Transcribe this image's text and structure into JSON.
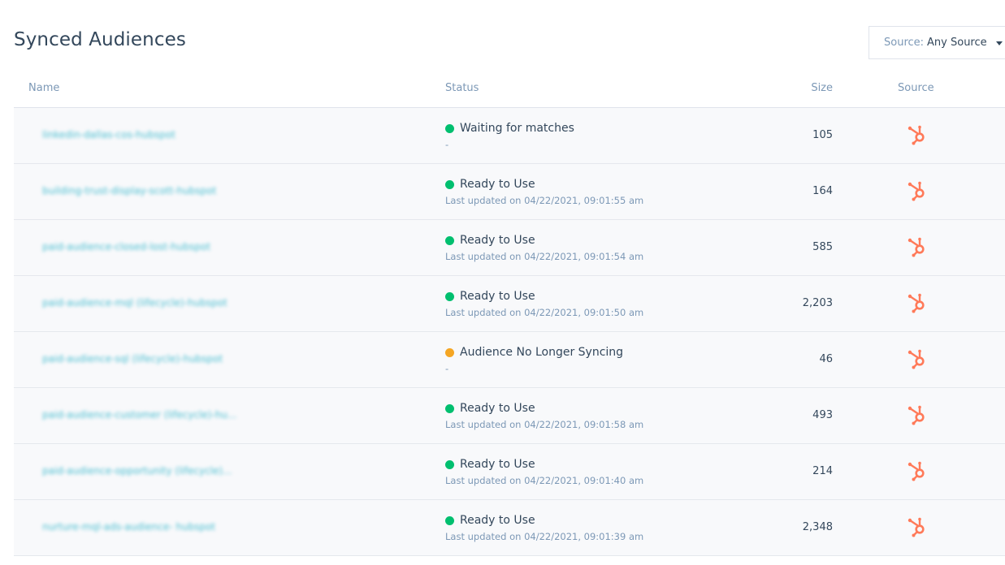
{
  "page": {
    "title": "Synced Audiences"
  },
  "filter": {
    "label": "Source:",
    "value": "Any Source"
  },
  "columns": {
    "name": "Name",
    "status": "Status",
    "size": "Size",
    "source": "Source"
  },
  "colors": {
    "ready": "#00bf6f",
    "warning": "#f5a623",
    "hubspot": "#ff7a59",
    "link": "#00a4bd"
  },
  "rows": [
    {
      "name": "linkedin-dallas-cos-hubspot",
      "status": "Waiting for matches",
      "status_color": "#00bf6f",
      "sub": "-",
      "size": "105",
      "source_icon": "hubspot-sprocket-icon"
    },
    {
      "name": "building-trust-display-scott-hubspot",
      "status": "Ready to Use",
      "status_color": "#00bf6f",
      "sub": "Last updated on 04/22/2021, 09:01:55 am",
      "size": "164",
      "source_icon": "hubspot-sprocket-icon"
    },
    {
      "name": "paid-audience-closed-lost-hubspot",
      "status": "Ready to Use",
      "status_color": "#00bf6f",
      "sub": "Last updated on 04/22/2021, 09:01:54 am",
      "size": "585",
      "source_icon": "hubspot-sprocket-icon"
    },
    {
      "name": "paid-audience-mql (lifecycle)-hubspot",
      "status": "Ready to Use",
      "status_color": "#00bf6f",
      "sub": "Last updated on 04/22/2021, 09:01:50 am",
      "size": "2,203",
      "source_icon": "hubspot-sprocket-icon"
    },
    {
      "name": "paid-audience-sql (lifecycle)-hubspot",
      "status": "Audience No Longer Syncing",
      "status_color": "#f5a623",
      "sub": "-",
      "size": "46",
      "source_icon": "hubspot-sprocket-icon"
    },
    {
      "name": "paid-audience-customer (lifecycle)-hu...",
      "status": "Ready to Use",
      "status_color": "#00bf6f",
      "sub": "Last updated on 04/22/2021, 09:01:58 am",
      "size": "493",
      "source_icon": "hubspot-sprocket-icon"
    },
    {
      "name": "paid-audience-opportunity (lifecycle)...",
      "status": "Ready to Use",
      "status_color": "#00bf6f",
      "sub": "Last updated on 04/22/2021, 09:01:40 am",
      "size": "214",
      "source_icon": "hubspot-sprocket-icon"
    },
    {
      "name": "nurture-mql-ads-audience- hubspot",
      "status": "Ready to Use",
      "status_color": "#00bf6f",
      "sub": "Last updated on 04/22/2021, 09:01:39 am",
      "size": "2,348",
      "source_icon": "hubspot-sprocket-icon"
    }
  ]
}
